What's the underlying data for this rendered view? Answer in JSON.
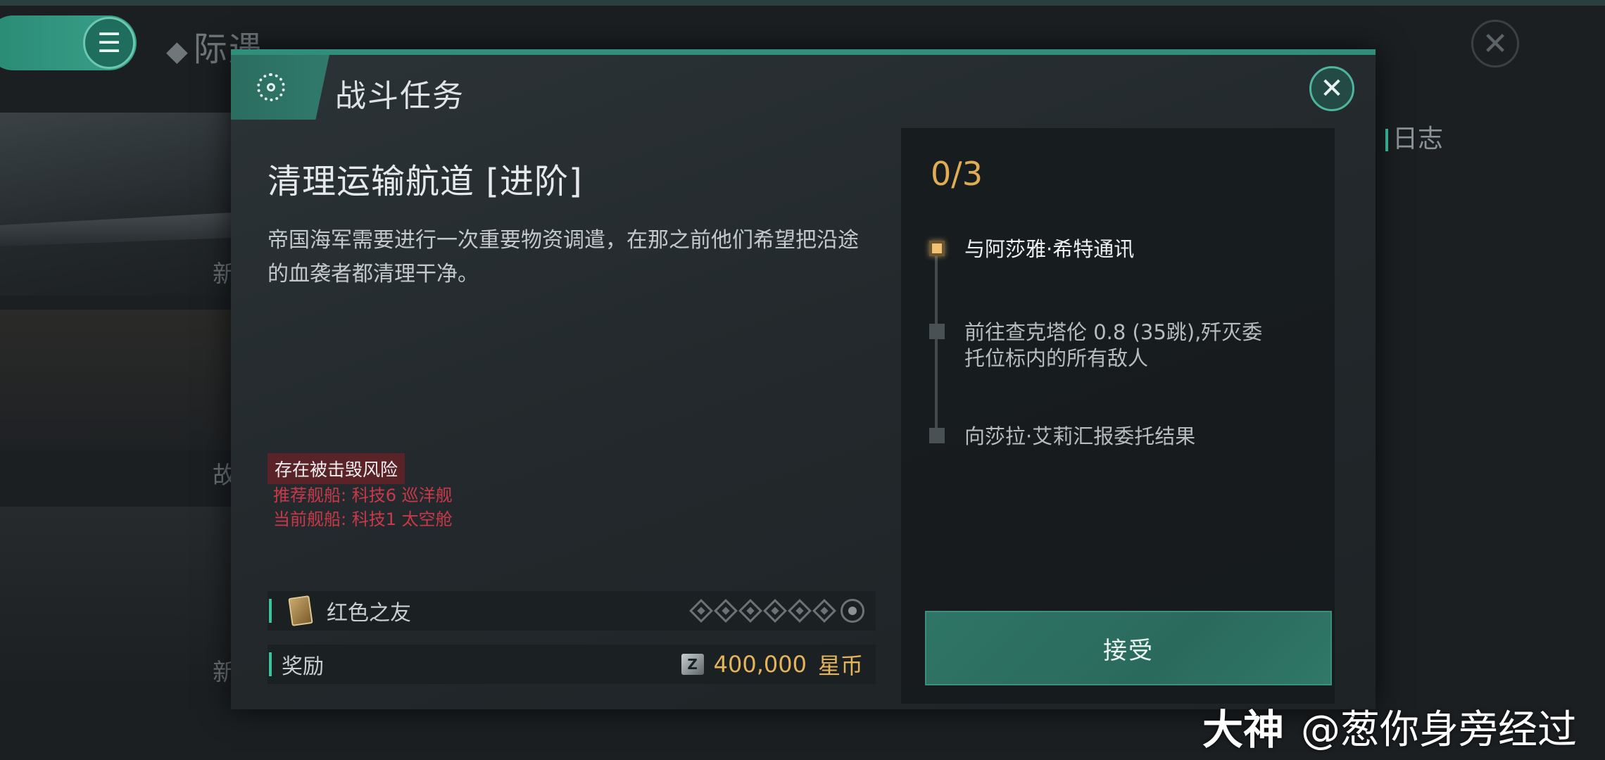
{
  "app": {
    "title": "际遇"
  },
  "background": {
    "chars": [
      "新",
      "故",
      "新"
    ],
    "right_title": "日志"
  },
  "modal": {
    "title": "战斗任务",
    "mission_name": "清理运输航道 [进阶]",
    "description": "帝国海军需要进行一次重要物资调遣，在那之前他们希望把沿途的血袭者都清理干净。",
    "risk": {
      "warning": "存在被击毁风险",
      "recommended": "推荐舰船: 科技6 巡洋舰",
      "current": "当前舰船: 科技1 太空舱"
    },
    "faction": {
      "label": "红色之友",
      "stars_total": 7,
      "stars_filled": 0
    },
    "reward": {
      "label": "奖励",
      "amount": "400,000",
      "unit": "星币",
      "icon_text": "Z"
    },
    "progress": "0/3",
    "steps": [
      {
        "text": "与阿莎雅·希特通讯",
        "active": true
      },
      {
        "text": "前往查克塔伦 0.8 (35跳),歼灭委托位标内的所有敌人",
        "active": false
      },
      {
        "text": "向莎拉·艾莉汇报委托结果",
        "active": false
      }
    ],
    "accept_label": "接受"
  },
  "watermark": {
    "brand": "大神",
    "handle": "@葱你身旁经过"
  },
  "colors": {
    "accent": "#2f8f7b",
    "gold": "#e4b35a",
    "danger": "#c9394a"
  }
}
